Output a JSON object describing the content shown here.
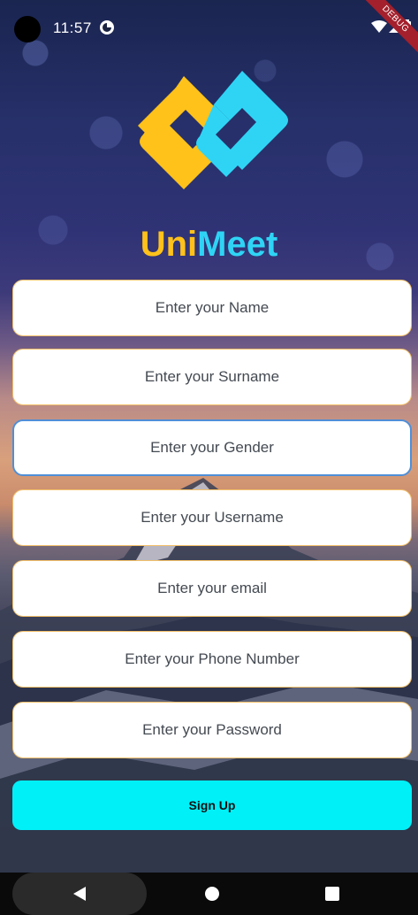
{
  "status_bar": {
    "time": "11:57",
    "debug_label": "DEBUG"
  },
  "app": {
    "title_part1": "Uni",
    "title_part2": "Meet",
    "accent_yellow": "#ffc21a",
    "accent_cyan": "#2fd4f5"
  },
  "form": {
    "fields": [
      {
        "placeholder": "Enter your Name",
        "value": ""
      },
      {
        "placeholder": "Enter your Surname",
        "value": ""
      },
      {
        "placeholder": "Enter your Gender",
        "value": "",
        "focused": true
      },
      {
        "placeholder": "Enter your Username",
        "value": ""
      },
      {
        "placeholder": "Enter your email",
        "value": ""
      },
      {
        "placeholder": "Enter your Phone Number",
        "value": ""
      },
      {
        "placeholder": "Enter your Password",
        "value": ""
      }
    ],
    "submit_label": "Sign Up",
    "submit_color": "#00f0f8"
  },
  "nav_bar": {
    "icons": [
      "back-icon",
      "home-icon",
      "recents-icon"
    ]
  }
}
